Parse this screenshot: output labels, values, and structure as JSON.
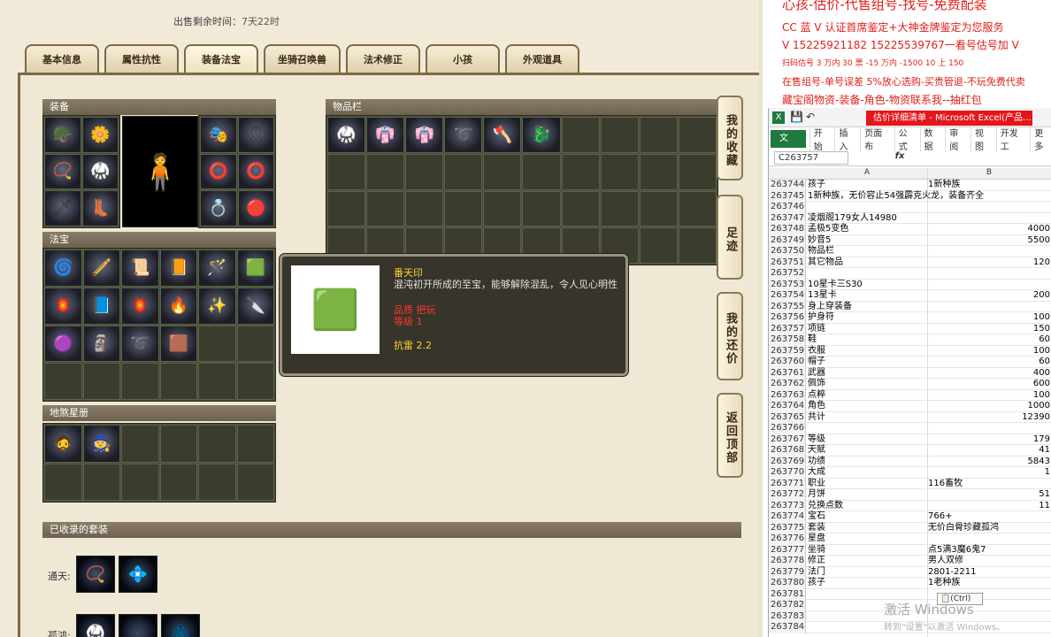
{
  "page": {
    "sale_remaining_label": "出售剩余时间：",
    "sale_remaining_value": "7天22时"
  },
  "tabs": [
    "基本信息",
    "属性抗性",
    "装备法宝",
    "坐骑召唤兽",
    "法术修正",
    "小孩",
    "外观道具"
  ],
  "active_tab": 2,
  "sections": {
    "equipment": "装备",
    "treasure": "法宝",
    "inventory": "物品栏",
    "stars": "地煞星册",
    "collected_sets": "已收录的套装"
  },
  "tooltip": {
    "name": "番天印",
    "desc": "混沌初开所成的至宝，能够解除混乱，令人见心明性",
    "line1": "品质  把玩",
    "line2": "等级  1",
    "resist": "抗雷 2.2"
  },
  "side_nav": [
    "我的收藏",
    "足迹",
    "我的还价",
    "返回顶部"
  ],
  "sets": [
    {
      "label": "通天:"
    },
    {
      "label": "孤鸿:"
    }
  ],
  "promo": [
    "心孩-估价-代售组号-找号-免费配装",
    "CC 蓝 V 认证首席鉴定+大神金牌鉴定为您服务",
    "V 15225921182      15225539767一看号估号加 V",
    "扫码估号 3 万内 30 票 -15 万内 -1500 10 上 150",
    "在售组号-单号误差 5%放心选购-买贵管退-不玩免费代卖",
    "藏宝阁物资-装备-角色-物资联系我--抽红包"
  ],
  "excel": {
    "title": "估价详细清单 - Microsoft Excel(产品...",
    "file_tab": "文件",
    "ribbon": [
      "开始",
      "插入",
      "页面布",
      "公式",
      "数据",
      "审阅",
      "视图",
      "开发工",
      "更多"
    ],
    "name_box": "C263757",
    "fx": "fx",
    "col_a": "A",
    "col_b": "B",
    "paste": "(Ctrl)",
    "watermark": "激活 Windows",
    "watermark2": "转到\"设置\"以激活 Windows。",
    "rows": [
      {
        "n": "263744",
        "a": "孩子",
        "b": "1新种族"
      },
      {
        "n": "263745",
        "a": "1新种族，无价容止54强霹克火龙，装备齐全",
        "b": ""
      },
      {
        "n": "263746",
        "a": "",
        "b": ""
      },
      {
        "n": "263747",
        "a": "凌烟阁179女人14980",
        "b": ""
      },
      {
        "n": "263748",
        "a": "孟极5变色",
        "b": "4000"
      },
      {
        "n": "263749",
        "a": "妙音5",
        "b": "5500"
      },
      {
        "n": "263750",
        "a": "物品栏",
        "b": ""
      },
      {
        "n": "263751",
        "a": "其它物品",
        "b": "120"
      },
      {
        "n": "263752",
        "a": "",
        "b": ""
      },
      {
        "n": "263753",
        "a": "10星卡三S30",
        "b": ""
      },
      {
        "n": "263754",
        "a": "13星卡",
        "b": "200"
      },
      {
        "n": "263755",
        "a": "身上穿装备",
        "b": ""
      },
      {
        "n": "263756",
        "a": "护身符",
        "b": "100"
      },
      {
        "n": "263757",
        "a": "项链",
        "b": "150"
      },
      {
        "n": "263758",
        "a": "鞋",
        "b": "60"
      },
      {
        "n": "263759",
        "a": "衣服",
        "b": "100"
      },
      {
        "n": "263760",
        "a": "帽子",
        "b": "60"
      },
      {
        "n": "263761",
        "a": "武器",
        "b": "400"
      },
      {
        "n": "263762",
        "a": "佩饰",
        "b": "600"
      },
      {
        "n": "263763",
        "a": "点粹",
        "b": "100"
      },
      {
        "n": "263764",
        "a": "角色",
        "b": "1000"
      },
      {
        "n": "263765",
        "a": "共计",
        "b": "12390"
      },
      {
        "n": "263766",
        "a": "",
        "b": ""
      },
      {
        "n": "263767",
        "a": "等级",
        "b": "179"
      },
      {
        "n": "263768",
        "a": "天赋",
        "b": "41"
      },
      {
        "n": "263769",
        "a": "功绩",
        "b": "5843"
      },
      {
        "n": "263770",
        "a": "大成",
        "b": "1"
      },
      {
        "n": "263771",
        "a": "职业",
        "b": "116畜牧"
      },
      {
        "n": "263772",
        "a": "月饼",
        "b": "51"
      },
      {
        "n": "263773",
        "a": "兑换点数",
        "b": "11"
      },
      {
        "n": "263774",
        "a": "宝石",
        "b": "766+"
      },
      {
        "n": "263775",
        "a": "套装",
        "b": "无价白骨珍藏孤鸿"
      },
      {
        "n": "263776",
        "a": "星盘",
        "b": ""
      },
      {
        "n": "263777",
        "a": "坐骑",
        "b": "点5满3魔6鬼7"
      },
      {
        "n": "263778",
        "a": "修正",
        "b": "男人双修"
      },
      {
        "n": "263779",
        "a": "法门",
        "b": "2801-2211"
      },
      {
        "n": "263780",
        "a": "孩子",
        "b": "1老种族"
      },
      {
        "n": "263781",
        "a": "",
        "b": ""
      },
      {
        "n": "263782",
        "a": "",
        "b": ""
      },
      {
        "n": "263783",
        "a": "",
        "b": ""
      },
      {
        "n": "263784",
        "a": "",
        "b": ""
      }
    ]
  }
}
